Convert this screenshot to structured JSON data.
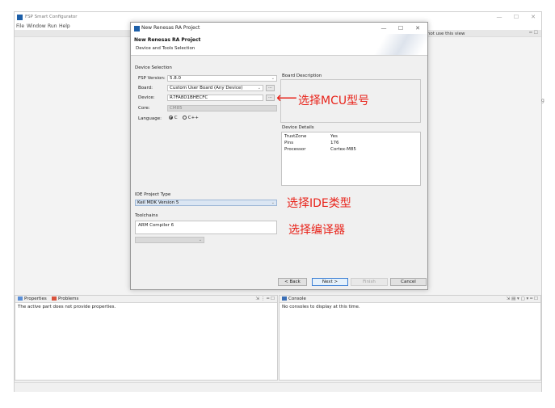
{
  "app": {
    "title": "FSP Smart Configurator",
    "logo_color": "#1d5fa8"
  },
  "menu": [
    "File",
    "Window",
    "Run",
    "Help"
  ],
  "window_controls": {
    "minimize": "—",
    "maximize": "☐",
    "close": "✕"
  },
  "editor": {
    "hint": "does not use this view",
    "edge_glyph": "g",
    "top_minmax": "━ ☐"
  },
  "properties_pane": {
    "tab_properties": "Properties",
    "tab_problems": "Problems",
    "message": "The active part does not provide properties.",
    "tools": "⇲ ⋮ ━ ☐"
  },
  "console_pane": {
    "tab_console": "Console",
    "message": "No consoles to display at this time.",
    "tools": "⇲ ▤ ▾ ▢ ▾ ━ ☐"
  },
  "dialog": {
    "title": "New Renesas RA Project",
    "heading": "New Renesas RA Project",
    "subheading": "Device and Tools Selection",
    "device_selection": {
      "section_label": "Device Selection",
      "fsp_version_label": "FSP Version:",
      "fsp_version": "5.8.0",
      "board_label": "Board:",
      "board": "Custom User Board (Any Device)",
      "device_label": "Device:",
      "device": "R7FA8D1BHECFC",
      "core_label": "Core:",
      "core": "CM85",
      "language_label": "Language:",
      "language_options": [
        "C",
        "C++"
      ],
      "language_selected": "C",
      "browse_label": "..."
    },
    "board_description": {
      "label": "Board Description"
    },
    "device_details": {
      "label": "Device Details",
      "rows": [
        {
          "key": "TrustZone",
          "value": "Yes"
        },
        {
          "key": "Pins",
          "value": "176"
        },
        {
          "key": "Processor",
          "value": "Cortex-M85"
        }
      ]
    },
    "ide_project_type": {
      "label": "IDE Project Type",
      "value": "Keil MDK Version 5"
    },
    "toolchains": {
      "label": "Toolchains",
      "value": "ARM Compiler 6"
    },
    "buttons": {
      "back": "< Back",
      "next": "Next >",
      "finish": "Finish",
      "cancel": "Cancel"
    }
  },
  "annotations": {
    "mcu": "选择MCU型号",
    "ide": "选择IDE类型",
    "compiler": "选择编译器",
    "arrow": "⟵",
    "color": "#e8241b"
  }
}
